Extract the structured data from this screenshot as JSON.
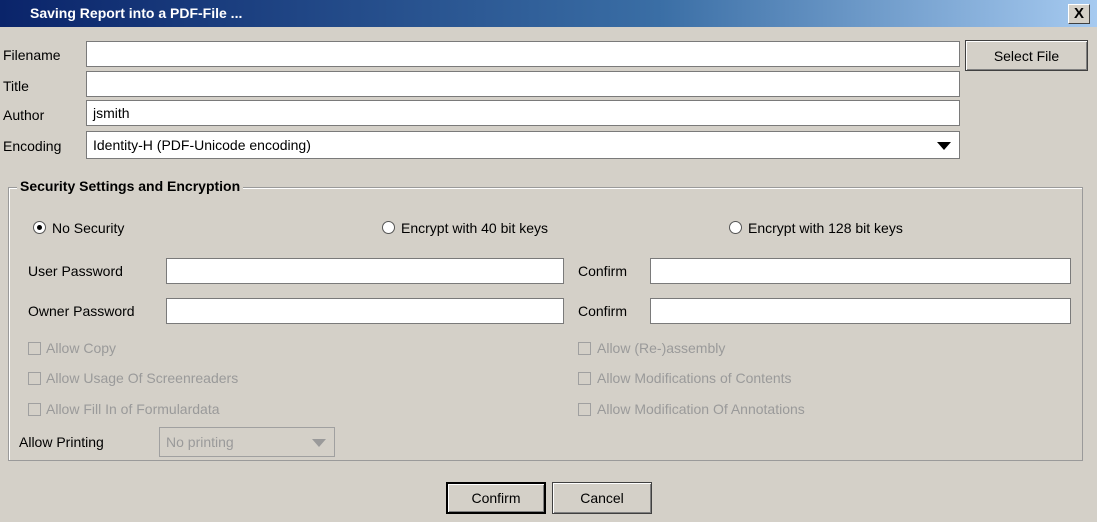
{
  "window": {
    "title": "Saving Report into a PDF-File ...",
    "close_label": "X"
  },
  "form": {
    "filename_label": "Filename",
    "filename_value": "",
    "select_file_label": "Select File",
    "title_label": "Title",
    "title_value": "",
    "author_label": "Author",
    "author_value": "jsmith",
    "encoding_label": "Encoding",
    "encoding_value": "Identity-H (PDF-Unicode encoding)"
  },
  "security": {
    "group_title": "Security Settings and Encryption",
    "radio_none": "No Security",
    "radio_40": "Encrypt with 40 bit keys",
    "radio_128": "Encrypt with 128 bit keys",
    "selected": "No Security",
    "user_password_label": "User Password",
    "owner_password_label": "Owner Password",
    "confirm_label": "Confirm",
    "allow_copy": "Allow Copy",
    "allow_screenreaders": "Allow Usage Of Screenreaders",
    "allow_fill_in": "Allow Fill In of Formulardata",
    "allow_reassembly": "Allow (Re-)assembly",
    "allow_modifications": "Allow Modifications of Contents",
    "allow_annotations": "Allow Modification Of Annotations",
    "allow_printing_label": "Allow Printing",
    "allow_printing_value": "No printing"
  },
  "footer": {
    "confirm_label": "Confirm",
    "cancel_label": "Cancel"
  }
}
